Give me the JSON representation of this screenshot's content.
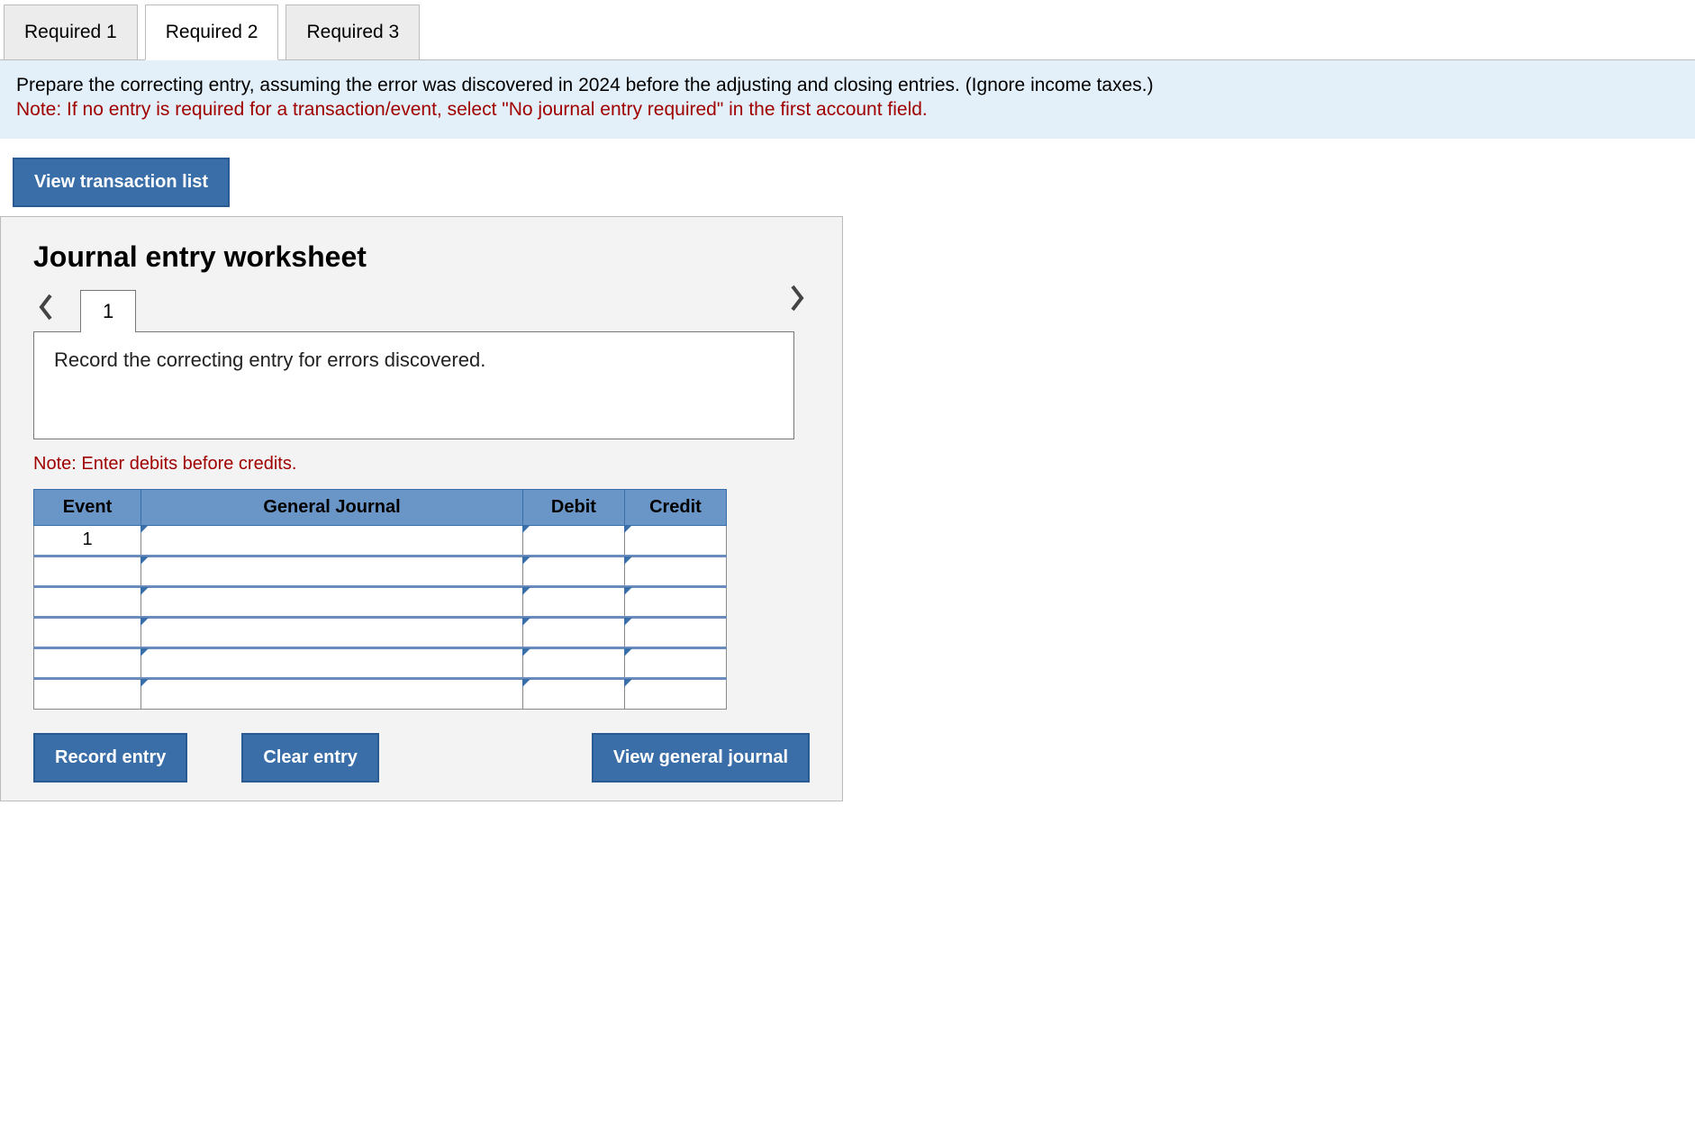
{
  "tabs": [
    {
      "label": "Required 1",
      "active": false
    },
    {
      "label": "Required 2",
      "active": true
    },
    {
      "label": "Required 3",
      "active": false
    }
  ],
  "instructions": {
    "line1": "Prepare the correcting entry, assuming the error was discovered in 2024 before the adjusting and closing entries. (Ignore income taxes.)",
    "line2": "Note: If no entry is required for a transaction/event, select \"No journal entry required\" in the first account field."
  },
  "buttons": {
    "view_transaction_list": "View transaction list",
    "record_entry": "Record entry",
    "clear_entry": "Clear entry",
    "view_general_journal": "View general journal"
  },
  "worksheet": {
    "title": "Journal entry worksheet",
    "entry_tab": "1",
    "instruction": "Record the correcting entry for errors discovered.",
    "note": "Note: Enter debits before credits.",
    "headers": {
      "event": "Event",
      "general_journal": "General Journal",
      "debit": "Debit",
      "credit": "Credit"
    },
    "rows": [
      {
        "event": "1",
        "gj": "",
        "debit": "",
        "credit": ""
      },
      {
        "event": "",
        "gj": "",
        "debit": "",
        "credit": ""
      },
      {
        "event": "",
        "gj": "",
        "debit": "",
        "credit": ""
      },
      {
        "event": "",
        "gj": "",
        "debit": "",
        "credit": ""
      },
      {
        "event": "",
        "gj": "",
        "debit": "",
        "credit": ""
      },
      {
        "event": "",
        "gj": "",
        "debit": "",
        "credit": ""
      }
    ]
  }
}
